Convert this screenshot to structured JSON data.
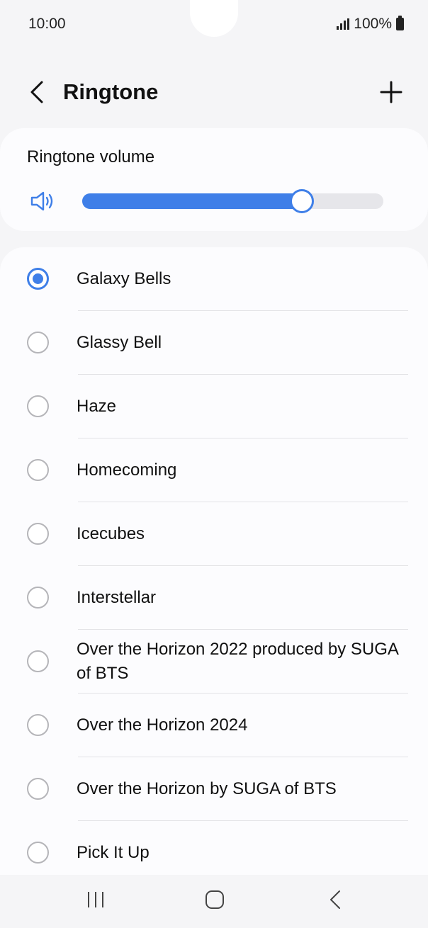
{
  "status_bar": {
    "time": "10:00",
    "battery": "100%",
    "icons": [
      "signal-icon",
      "battery-icon"
    ]
  },
  "header": {
    "title": "Ringtone",
    "back_icon": "chevron-left-icon",
    "add_icon": "plus-icon"
  },
  "volume": {
    "label": "Ringtone volume",
    "icon": "speaker-icon",
    "level": 0.73
  },
  "ringtones": [
    {
      "label": "Galaxy Bells",
      "selected": true
    },
    {
      "label": "Glassy Bell",
      "selected": false
    },
    {
      "label": "Haze",
      "selected": false
    },
    {
      "label": "Homecoming",
      "selected": false
    },
    {
      "label": "Icecubes",
      "selected": false
    },
    {
      "label": "Interstellar",
      "selected": false
    },
    {
      "label": "Over the Horizon 2022 produced by SUGA of BTS",
      "selected": false
    },
    {
      "label": "Over the Horizon 2024",
      "selected": false
    },
    {
      "label": "Over the Horizon by SUGA of BTS",
      "selected": false
    },
    {
      "label": "Pick It Up",
      "selected": false
    }
  ],
  "nav_bar": {
    "icons": [
      "recent-apps-icon",
      "home-icon",
      "back-icon"
    ]
  },
  "colors": {
    "accent": "#3f7fe8",
    "background": "#f5f5f7",
    "card": "#fcfcfe"
  }
}
